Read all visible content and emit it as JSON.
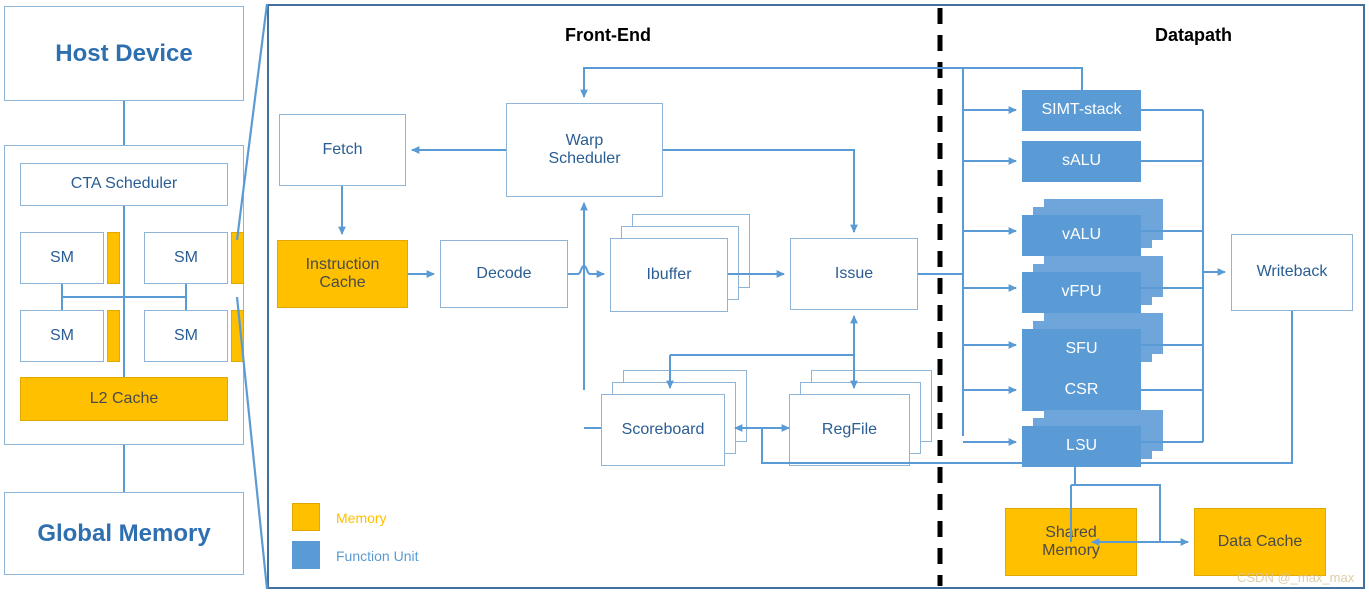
{
  "left_panel": {
    "host_device": "Host Device",
    "gpu": {
      "cta_scheduler": "CTA Scheduler",
      "sms": [
        "SM",
        "SM",
        "SM",
        "SM"
      ],
      "l2_cache": "L2 Cache"
    },
    "global_memory": "Global Memory"
  },
  "right_panel": {
    "sections": [
      {
        "id": "front-end",
        "title": "Front-End"
      },
      {
        "id": "datapath",
        "title": "Datapath"
      }
    ],
    "front_end": {
      "fetch": "Fetch",
      "warp_scheduler": "Warp\nScheduler",
      "warp_scheduler_line1": "Warp",
      "warp_scheduler_line2": "Scheduler",
      "instruction_cache_line1": "Instruction",
      "instruction_cache_line2": "Cache",
      "decode": "Decode",
      "ibuffer": "Ibuffer",
      "issue": "Issue",
      "scoreboard": "Scoreboard",
      "regfile": "RegFile"
    },
    "datapath": {
      "units": [
        {
          "label": "SIMT-stack",
          "stacked": false
        },
        {
          "label": "sALU",
          "stacked": false
        },
        {
          "label": "vALU",
          "stacked": true
        },
        {
          "label": "vFPU",
          "stacked": true
        },
        {
          "label": "SFU",
          "stacked": true
        },
        {
          "label": "CSR",
          "stacked": false
        },
        {
          "label": "LSU",
          "stacked": true
        }
      ],
      "writeback": "Writeback",
      "shared_memory_line1": "Shared",
      "shared_memory_line2": "Memory",
      "data_cache": "Data Cache"
    },
    "legend": [
      {
        "label": "Memory",
        "color": "#FFC000"
      },
      {
        "label": "Function Unit",
        "color": "#5B9BD5"
      }
    ],
    "watermark": "CSDN @_max_max"
  },
  "colors": {
    "memory": "#FFC000",
    "function_unit": "#5B9BD5",
    "wire": "#5B9BD5",
    "panel_border": "#41719C",
    "box_text": "#2a5d93",
    "header_text": "#2e6fb0"
  }
}
